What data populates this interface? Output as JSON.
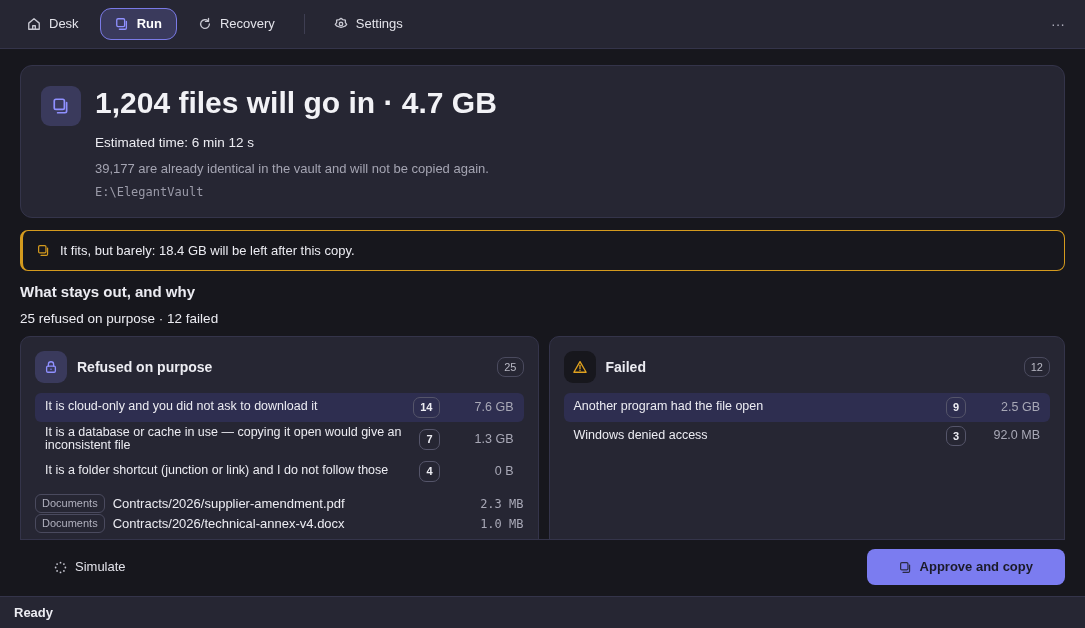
{
  "nav": {
    "tabs": [
      {
        "label": "Desk",
        "kind": "home",
        "selected": false
      },
      {
        "label": "Run",
        "kind": "copy",
        "selected": true
      },
      {
        "label": "Recovery",
        "kind": "refresh",
        "selected": false
      },
      {
        "label": "Settings",
        "kind": "gear",
        "selected": false,
        "separator_before": true
      }
    ],
    "more": "···"
  },
  "summary": {
    "title": "1,204 files will go in · 4.7 GB",
    "estimate": "Estimated time: 6 min 12 s",
    "note": "39,177 are already identical in the vault and will not be copied again.",
    "path": "E:\\ElegantVault"
  },
  "alert": {
    "text": "It fits, but barely: 18.4 GB will be left after this copy."
  },
  "section": {
    "heading": "What stays out, and why",
    "subtitle": "25 refused on purpose · 12 failed"
  },
  "panels": [
    {
      "title": "Refused on purpose",
      "kind": "lock",
      "count": "25",
      "reasons": [
        {
          "text": "It is cloud-only and you did not ask to download it",
          "count": "14",
          "size": "7.6 GB",
          "selected": true
        },
        {
          "text": "It is a database or cache in use — copying it open would give an inconsistent file",
          "count": "7",
          "size": "1.3 GB",
          "selected": false
        },
        {
          "text": "It is a folder shortcut (junction or link) and I do not follow those",
          "count": "4",
          "size": "0 B",
          "selected": false
        }
      ],
      "files": [
        {
          "tag": "Documents",
          "path": "Contracts/2026/supplier-amendment.pdf",
          "size": "2.3 MB"
        },
        {
          "tag": "Documents",
          "path": "Contracts/2026/technical-annex-v4.docx",
          "size": "1.0 MB"
        }
      ]
    },
    {
      "title": "Failed",
      "kind": "warning",
      "count": "12",
      "reasons": [
        {
          "text": "Another program had the file open",
          "count": "9",
          "size": "2.5 GB",
          "selected": true
        },
        {
          "text": "Windows denied access",
          "count": "3",
          "size": "92.0 MB",
          "selected": false
        }
      ]
    }
  ],
  "actions": {
    "simulate": "Simulate",
    "approve": "Approve and copy"
  },
  "status_bar": "Ready"
}
